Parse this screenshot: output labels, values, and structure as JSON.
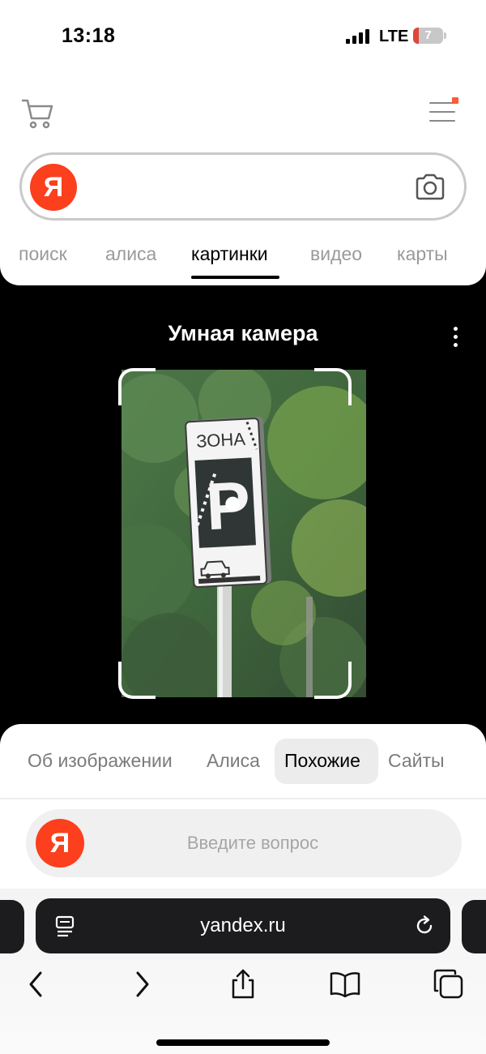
{
  "status_bar": {
    "time": "13:18",
    "network": "LTE",
    "battery_level": "7",
    "battery_fraction": 0.07
  },
  "header": {
    "cart_icon": "shopping-cart-icon",
    "menu_icon": "hamburger-menu-icon",
    "menu_notification_color": "#ff5a36",
    "search": {
      "logo": "Я",
      "placeholder": "",
      "camera_icon": "camera-icon",
      "logo_color": "#fc3f1d"
    },
    "tabs": [
      {
        "label": "поиск",
        "active": false
      },
      {
        "label": "алиса",
        "active": false
      },
      {
        "label": "картинки",
        "active": true
      },
      {
        "label": "видео",
        "active": false
      },
      {
        "label": "карты",
        "active": false
      }
    ]
  },
  "camera": {
    "title": "Умная камера",
    "more_icon": "more-vertical-icon",
    "sign": {
      "zone_text": "ЗОНА",
      "parking_letter": "P"
    }
  },
  "results": {
    "tabs": [
      {
        "label": "Об изображении",
        "active": false
      },
      {
        "label": "Алиса",
        "active": false
      },
      {
        "label": "Похожие",
        "active": true
      },
      {
        "label": "Сайты",
        "active": false
      }
    ],
    "ask": {
      "logo": "Я",
      "placeholder": "Введите вопрос"
    }
  },
  "safari": {
    "url": "yandex.ru",
    "reader_icon": "page-menu-icon",
    "reload_icon": "reload-icon",
    "toolbar": [
      "back-icon",
      "forward-icon",
      "share-icon",
      "bookmarks-icon",
      "tabs-icon"
    ]
  }
}
